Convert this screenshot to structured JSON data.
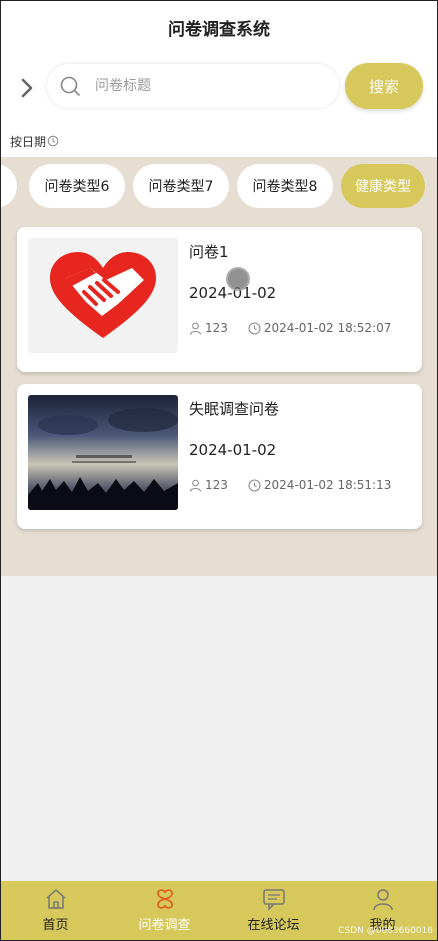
{
  "header": {
    "title": "问卷调查系统"
  },
  "search": {
    "placeholder": "问卷标题",
    "button_label": "搜索"
  },
  "sort": {
    "label": "按日期"
  },
  "tabs": [
    {
      "label": ""
    },
    {
      "label": "问卷类型6"
    },
    {
      "label": "问卷类型7"
    },
    {
      "label": "问卷类型8"
    },
    {
      "label": "健康类型",
      "active": true
    }
  ],
  "cards": [
    {
      "title": "问卷1",
      "date": "2024-01-02",
      "count": "123",
      "timestamp": "2024-01-02 18:52:07",
      "thumb_icon": "handshake-heart-icon"
    },
    {
      "title": "失眠调查问卷",
      "date": "2024-01-02",
      "count": "123",
      "timestamp": "2024-01-02 18:51:13",
      "thumb_icon": "night-sky-photo"
    }
  ],
  "bottom_nav": [
    {
      "label": "首页",
      "icon": "home-icon"
    },
    {
      "label": "问卷调查",
      "icon": "survey-icon",
      "active": true
    },
    {
      "label": "在线论坛",
      "icon": "forum-icon"
    },
    {
      "label": "我的",
      "icon": "user-icon"
    }
  ],
  "watermark": "CSDN @0083660016",
  "colors": {
    "accent": "#d6c85a",
    "content_bg": "#e6ded3",
    "active_icon": "#e05a1e"
  }
}
